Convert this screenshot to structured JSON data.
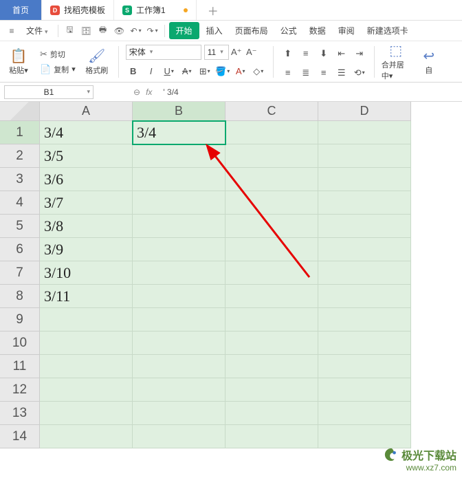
{
  "tabs": {
    "home": "首页",
    "template": "找稻壳模板",
    "workbook": "工作簿1"
  },
  "menu": {
    "file": "文件",
    "start": "开始",
    "insert": "插入",
    "page_layout": "页面布局",
    "formulas": "公式",
    "data": "数据",
    "review": "审阅",
    "new_tab": "新建选项卡"
  },
  "ribbon": {
    "paste": "粘贴",
    "cut": "剪切",
    "copy": "复制",
    "format_painter": "格式刷",
    "font_name": "宋体",
    "font_size": "11",
    "merge_center": "合并居中",
    "auto": "自"
  },
  "formula_bar": {
    "cell_ref": "B1",
    "fx": "fx",
    "formula_text": "' 3/4"
  },
  "columns": [
    "A",
    "B",
    "C",
    "D"
  ],
  "rows": [
    "1",
    "2",
    "3",
    "4",
    "5",
    "6",
    "7",
    "8",
    "9",
    "10",
    "11",
    "12",
    "13",
    "14"
  ],
  "cells": {
    "A1": "3/4",
    "A2": "3/5",
    "A3": "3/6",
    "A4": "3/7",
    "A5": "3/8",
    "A6": "3/9",
    "A7": "3/10",
    "A8": "3/11",
    "B1": "3/4"
  },
  "active_cell": "B1",
  "watermark": {
    "name": "极光下载站",
    "url": "www.xz7.com"
  }
}
